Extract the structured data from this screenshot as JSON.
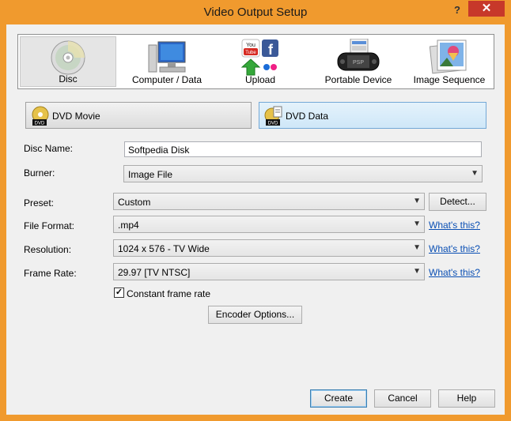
{
  "window": {
    "title": "Video Output Setup",
    "help_glyph": "?",
    "close_glyph": "✕"
  },
  "categories": [
    {
      "label": "Disc",
      "icon": "disc-icon"
    },
    {
      "label": "Computer / Data",
      "icon": "computer-icon"
    },
    {
      "label": "Upload",
      "icon": "upload-icon"
    },
    {
      "label": "Portable Device",
      "icon": "portable-device-icon"
    },
    {
      "label": "Image Sequence",
      "icon": "image-sequence-icon"
    }
  ],
  "disc_types": [
    {
      "label": "DVD Movie",
      "selected": false
    },
    {
      "label": "DVD Data",
      "selected": true
    }
  ],
  "form": {
    "disc_name_label": "Disc Name:",
    "disc_name_value": "Softpedia Disk",
    "burner_label": "Burner:",
    "burner_value": "Image File",
    "preset_label": "Preset:",
    "preset_value": "Custom",
    "detect_label": "Detect...",
    "file_format_label": "File Format:",
    "file_format_value": ".mp4",
    "resolution_label": "Resolution:",
    "resolution_value": "1024 x 576 - TV Wide",
    "frame_rate_label": "Frame Rate:",
    "frame_rate_value": "29.97 [TV NTSC]",
    "whats_this": "What's this?",
    "constant_frame_rate_label": "Constant frame rate",
    "constant_frame_rate_checked": true,
    "encoder_options_label": "Encoder Options..."
  },
  "footer": {
    "create": "Create",
    "cancel": "Cancel",
    "help": "Help"
  },
  "colors": {
    "title_bar": "#f09a2e",
    "close_button": "#c7382a",
    "selected_tab": "#cfe7f8",
    "link": "#0a4fb4"
  }
}
